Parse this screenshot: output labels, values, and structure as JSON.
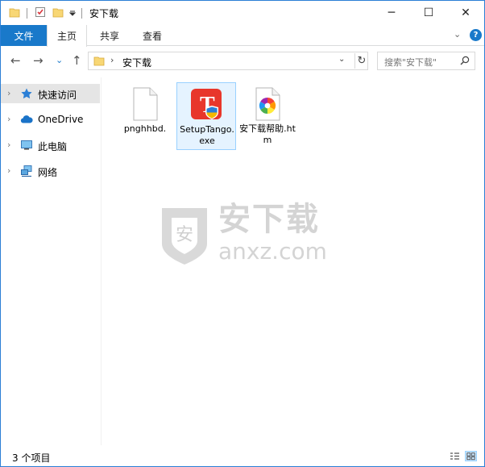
{
  "window": {
    "title": "安下载",
    "controls": {
      "minimize": "─",
      "maximize": "☐",
      "close": "✕"
    }
  },
  "ribbon": {
    "file_tab": "文件",
    "tabs": [
      {
        "label": "主页",
        "active": true
      },
      {
        "label": "共享",
        "active": false
      },
      {
        "label": "查看",
        "active": false
      }
    ],
    "expand_chevron": "⌄",
    "help": "?"
  },
  "nav": {
    "back": "←",
    "forward": "→",
    "recent": "⌄",
    "up": "↑",
    "address_sep": "›",
    "address_path": "安下载",
    "address_dropdown": "⌄",
    "refresh": "↻",
    "search_placeholder": "搜索\"安下载\""
  },
  "sidebar": {
    "items": [
      {
        "label": "快速访问",
        "icon": "star-icon",
        "selected": true
      },
      {
        "label": "OneDrive",
        "icon": "cloud-icon",
        "selected": false
      },
      {
        "label": "此电脑",
        "icon": "computer-icon",
        "selected": false
      },
      {
        "label": "网络",
        "icon": "network-icon",
        "selected": false
      }
    ],
    "chevron": "›"
  },
  "files": [
    {
      "name": "pnghhbd.",
      "icon": "blank-file-icon",
      "selected": false
    },
    {
      "name": "SetupTango.exe",
      "icon": "tango-installer-icon",
      "selected": true
    },
    {
      "name": "安下载帮助.htm",
      "icon": "htm-file-icon",
      "selected": false
    }
  ],
  "watermark": {
    "big": "安下载",
    "small": "anxz.com",
    "badge": "安"
  },
  "status": {
    "items_count": "3 个项目"
  },
  "colors": {
    "accent": "#1979ca",
    "selection": "#e5f3ff",
    "selection_border": "#99d1ff",
    "folder": "#f8d775"
  }
}
